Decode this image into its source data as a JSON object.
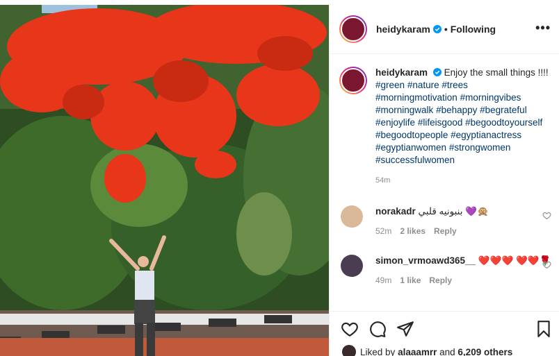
{
  "post": {
    "username": "heidykaram",
    "follow_separator": "•",
    "follow_status": "Following",
    "more_label": "•••"
  },
  "caption": {
    "username": "heidykaram",
    "text": "Enjoy the small things !!!!",
    "hashtags": [
      "#green",
      "#nature",
      "#trees",
      "#morningmotivation",
      "#morningvibes",
      "#morningwalk",
      "#behappy",
      "#begrateful",
      "#enjoylife",
      "#lifeisgood",
      "#begoodtoyourself",
      "#begoodtopeople",
      "#egyptianactress",
      "#egyptianwomen",
      "#strongwomen",
      "#successfulwomen"
    ],
    "time": "54m"
  },
  "comments": [
    {
      "username": "norakadr",
      "text": "بنبونيه قلبي 💜🙊",
      "time": "52m",
      "likes": "2 likes",
      "reply": "Reply"
    },
    {
      "username": "simon_vrmoawd365__",
      "text": "❤️❤️❤️ ❤️❤️🌹",
      "time": "49m",
      "likes": "1 like",
      "reply": "Reply"
    }
  ],
  "likes": {
    "prefix": "Liked by",
    "user": "alaaamrr",
    "and": "and",
    "others": "6,209 others"
  },
  "colors": {
    "link": "#00376b",
    "secondary": "#8e8e8e",
    "verified": "#0095f6",
    "flowers": "#e8361a"
  },
  "icons": [
    "verified-icon",
    "more-icon",
    "heart-icon",
    "comment-icon",
    "share-icon",
    "bookmark-icon"
  ]
}
